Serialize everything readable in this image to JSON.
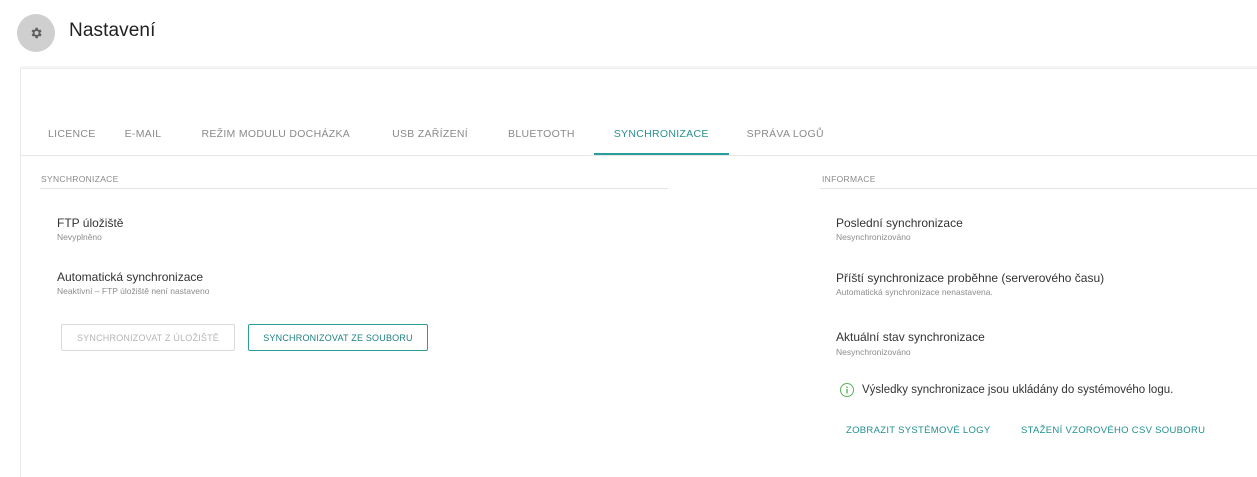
{
  "header": {
    "icon": "gear-icon",
    "title": "Nastavení"
  },
  "tabs": [
    {
      "label": "LICENCE",
      "active": false
    },
    {
      "label": "E-MAIL",
      "active": false
    },
    {
      "label": "REŽIM MODULU DOCHÁZKA",
      "active": false
    },
    {
      "label": "USB ZAŘÍZENÍ",
      "active": false
    },
    {
      "label": "BLUETOOTH",
      "active": false
    },
    {
      "label": "SYNCHRONIZACE",
      "active": true
    },
    {
      "label": "SPRÁVA LOGŮ",
      "active": false
    }
  ],
  "sync": {
    "section_label": "SYNCHRONIZACE",
    "ftp": {
      "title": "FTP úložiště",
      "value": "Nevyplněno"
    },
    "auto": {
      "title": "Automatická synchronizace",
      "value": "Neaktivní – FTP úložiště není nastaveno"
    },
    "buttons": {
      "from_storage": "SYNCHRONIZOVAT Z ÚLOŽIŠTĚ",
      "from_file": "SYNCHRONIZOVAT ZE SOUBORU"
    }
  },
  "info": {
    "section_label": "INFORMACE",
    "last_sync": {
      "title": "Poslední synchronizace",
      "value": "Nesynchronizováno"
    },
    "next_sync": {
      "title": "Příští synchronizace proběhne (serverového času)",
      "value": "Automatická synchronizace nenastavena."
    },
    "current_state": {
      "title": "Aktuální stav synchronizace",
      "value": "Nesynchronizováno"
    },
    "note": "Výsledky synchronizace jsou ukládány do systémového logu.",
    "links": {
      "show_logs": "ZOBRAZIT SYSTÉMOVÉ LOGY",
      "download_csv": "STAŽENÍ VZOROVÉHO CSV SOUBORU"
    }
  },
  "colors": {
    "accent": "#2a9d9d",
    "info_icon": "#59b35a"
  }
}
